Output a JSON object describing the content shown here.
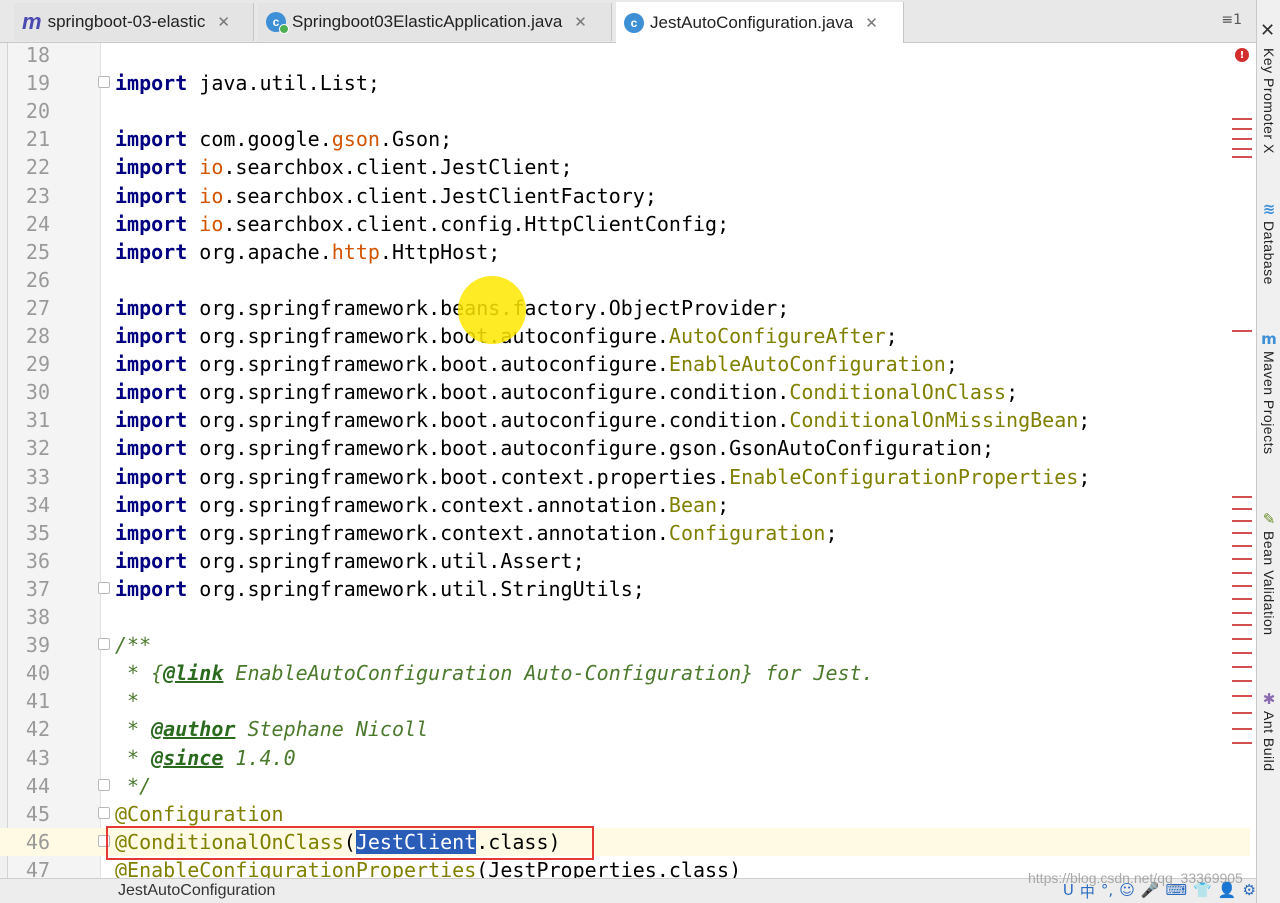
{
  "tabs": [
    {
      "label": "springboot-03-elastic",
      "icon": "module-icon",
      "active": false
    },
    {
      "label": "Springboot03ElasticApplication.java",
      "icon": "class-run-icon",
      "active": false
    },
    {
      "label": "JestAutoConfiguration.java",
      "icon": "class-icon",
      "active": true
    }
  ],
  "tab_menu": "≡1",
  "code_lines": [
    {
      "n": "18",
      "segs": []
    },
    {
      "n": "19",
      "segs": [
        [
          "kw",
          "import"
        ],
        [
          "",
          "java.util.List;"
        ]
      ]
    },
    {
      "n": "20",
      "segs": []
    },
    {
      "n": "21",
      "segs": [
        [
          "kw",
          "import"
        ],
        [
          "",
          "com.google."
        ],
        [
          "g",
          "gson"
        ],
        [
          "",
          ".Gson;"
        ]
      ]
    },
    {
      "n": "22",
      "segs": [
        [
          "kw",
          "import"
        ],
        [
          "g",
          "io"
        ],
        [
          "",
          ".searchbox.client.JestClient;"
        ]
      ]
    },
    {
      "n": "23",
      "segs": [
        [
          "kw",
          "import"
        ],
        [
          "g",
          "io"
        ],
        [
          "",
          ".searchbox.client.JestClientFactory;"
        ]
      ]
    },
    {
      "n": "24",
      "segs": [
        [
          "kw",
          "import"
        ],
        [
          "g",
          "io"
        ],
        [
          "",
          ".searchbox.client.config.HttpClientConfig;"
        ]
      ]
    },
    {
      "n": "25",
      "segs": [
        [
          "kw",
          "import"
        ],
        [
          "",
          "org.apache."
        ],
        [
          "g",
          "http"
        ],
        [
          "",
          ".HttpHost;"
        ]
      ]
    },
    {
      "n": "26",
      "segs": []
    },
    {
      "n": "27",
      "segs": [
        [
          "kw",
          "import"
        ],
        [
          "",
          "org.springframework.beans.factory.ObjectProvider;"
        ]
      ]
    },
    {
      "n": "28",
      "segs": [
        [
          "kw",
          "import"
        ],
        [
          "",
          "org.springframework.boot.autoconfigure."
        ],
        [
          "a",
          "AutoConfigureAfter"
        ],
        [
          "",
          ";"
        ]
      ]
    },
    {
      "n": "29",
      "segs": [
        [
          "kw",
          "import"
        ],
        [
          "",
          "org.springframework.boot.autoconfigure."
        ],
        [
          "a",
          "EnableAutoConfiguration"
        ],
        [
          "",
          ";"
        ]
      ]
    },
    {
      "n": "30",
      "segs": [
        [
          "kw",
          "import"
        ],
        [
          "",
          "org.springframework.boot.autoconfigure.condition."
        ],
        [
          "a",
          "ConditionalOnClass"
        ],
        [
          "",
          ";"
        ]
      ]
    },
    {
      "n": "31",
      "segs": [
        [
          "kw",
          "import"
        ],
        [
          "",
          "org.springframework.boot.autoconfigure.condition."
        ],
        [
          "a",
          "ConditionalOnMissingBean"
        ],
        [
          "",
          ";"
        ]
      ]
    },
    {
      "n": "32",
      "segs": [
        [
          "kw",
          "import"
        ],
        [
          "",
          "org.springframework.boot.autoconfigure.gson.GsonAutoConfiguration;"
        ]
      ]
    },
    {
      "n": "33",
      "segs": [
        [
          "kw",
          "import"
        ],
        [
          "",
          "org.springframework.boot.context.properties."
        ],
        [
          "a",
          "EnableConfigurationProperties"
        ],
        [
          "",
          ";"
        ]
      ]
    },
    {
      "n": "34",
      "segs": [
        [
          "kw",
          "import"
        ],
        [
          "",
          "org.springframework.context.annotation."
        ],
        [
          "a",
          "Bean"
        ],
        [
          "",
          ";"
        ]
      ]
    },
    {
      "n": "35",
      "segs": [
        [
          "kw",
          "import"
        ],
        [
          "",
          "org.springframework.context.annotation."
        ],
        [
          "a",
          "Configuration"
        ],
        [
          "",
          ";"
        ]
      ]
    },
    {
      "n": "36",
      "segs": [
        [
          "kw",
          "import"
        ],
        [
          "",
          "org.springframework.util.Assert;"
        ]
      ]
    },
    {
      "n": "37",
      "segs": [
        [
          "kw",
          "import"
        ],
        [
          "",
          "org.springframework.util.StringUtils;"
        ]
      ]
    },
    {
      "n": "38",
      "segs": []
    },
    {
      "n": "39",
      "segs": [
        [
          "doc",
          "/**"
        ]
      ]
    },
    {
      "n": "40",
      "segs": [
        [
          "doc",
          " * {"
        ],
        [
          "doctag",
          "@link"
        ],
        [
          "doc",
          " EnableAutoConfiguration Auto-Configuration} for Jest."
        ]
      ]
    },
    {
      "n": "41",
      "segs": [
        [
          "doc",
          " *"
        ]
      ]
    },
    {
      "n": "42",
      "segs": [
        [
          "doc",
          " * "
        ],
        [
          "doctag",
          "@author"
        ],
        [
          "doc",
          " Stephane Nicoll"
        ]
      ]
    },
    {
      "n": "43",
      "segs": [
        [
          "doc",
          " * "
        ],
        [
          "doctag",
          "@since"
        ],
        [
          "doc",
          " 1.4.0"
        ]
      ]
    },
    {
      "n": "44",
      "segs": [
        [
          "doc",
          " */"
        ]
      ]
    },
    {
      "n": "45",
      "segs": [
        [
          "ann",
          "@Configuration"
        ]
      ]
    },
    {
      "n": "46",
      "segs": [
        [
          "ann",
          "@ConditionalOnClass"
        ],
        [
          "",
          "("
        ],
        [
          "sel",
          "JestClient"
        ],
        [
          "",
          ".class)"
        ]
      ]
    },
    {
      "n": "47",
      "segs": [
        [
          "ann",
          "@EnableConfigurationProperties"
        ],
        [
          "",
          "(JestProperties.class)"
        ]
      ]
    }
  ],
  "status_text": "JestAutoConfiguration",
  "watermark": "https://blog.csdn.net/qq_33369905",
  "tray_icons": [
    "U",
    "中",
    "°,",
    "☺",
    "🎤",
    "⌨",
    "👕",
    "👤",
    "⚙"
  ],
  "right_tools": [
    {
      "label": "Key Promoter X",
      "icon": "key-promoter-icon",
      "glyph": "✕"
    },
    {
      "label": "Database",
      "icon": "database-icon",
      "glyph": "≋"
    },
    {
      "label": "Maven Projects",
      "icon": "maven-icon",
      "glyph": "m"
    },
    {
      "label": "Bean Validation",
      "icon": "bean-icon",
      "glyph": "✎"
    },
    {
      "label": "Ant Build",
      "icon": "ant-icon",
      "glyph": "✱"
    }
  ],
  "colors": {
    "keyword": "#000080",
    "annotation": "#808000",
    "doc": "#4b7a2e",
    "selection": "#2a5db8",
    "highlight": "#ffe600"
  }
}
